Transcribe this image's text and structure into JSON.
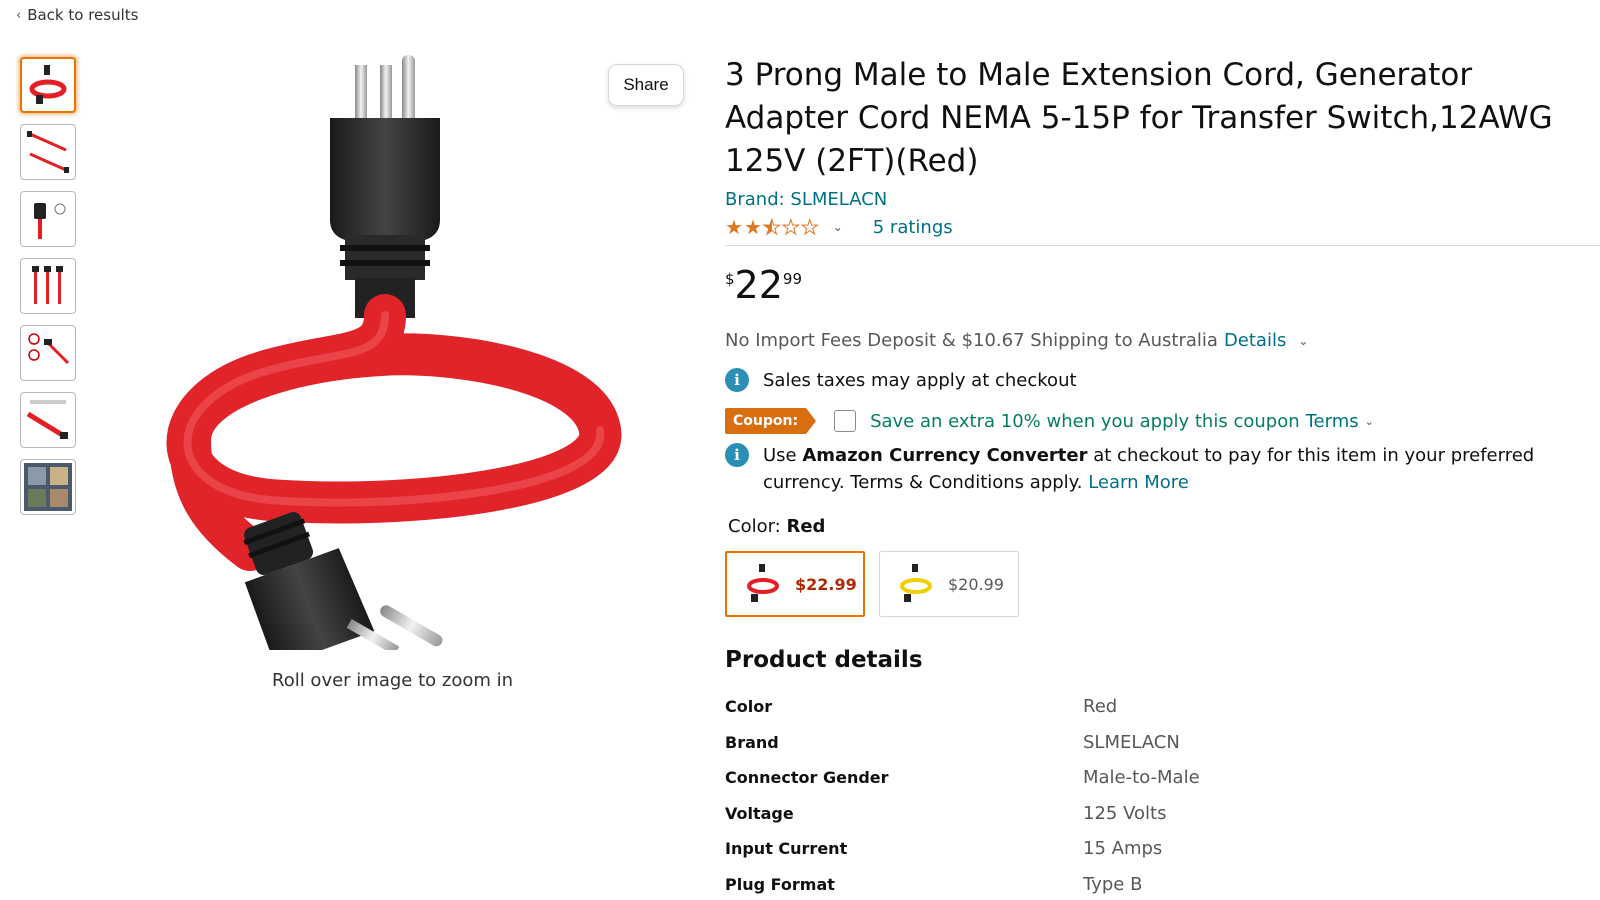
{
  "nav": {
    "back_label": "Back to results",
    "back_icon": "chevron-left-icon"
  },
  "gallery": {
    "thumbnails": [
      {
        "name": "red cord coiled"
      },
      {
        "name": "cord length diagram"
      },
      {
        "name": "plug detail"
      },
      {
        "name": "cords lined up"
      },
      {
        "name": "usage warnings"
      },
      {
        "name": "details drawing"
      },
      {
        "name": "application collage"
      }
    ],
    "share_label": "Share",
    "zoom_hint": "Roll over image to zoom in"
  },
  "product": {
    "title": "3 Prong Male to Male Extension Cord, Generator Adapter Cord NEMA 5-15P for Transfer Switch,12AWG 125V (2FT)(Red)",
    "brand": "Brand: SLMELACN",
    "rating": 2.5,
    "ratings_count": "5 ratings",
    "price": {
      "currency": "$",
      "whole": "22",
      "fraction": "99"
    },
    "shipping": {
      "text": "No Import Fees Deposit & $10.67 Shipping to Australia",
      "details_link": "Details"
    },
    "tax_note": "Sales taxes may apply at checkout",
    "coupon": {
      "tag": "Coupon:",
      "text": "Save an extra 10% when you apply this coupon",
      "terms": "Terms"
    },
    "converter": {
      "prefix": "Use",
      "bold": "Amazon Currency Converter",
      "suffix": "at checkout to pay for this item in your preferred currency. Terms & Conditions apply.",
      "link": "Learn More"
    },
    "color": {
      "label": "Color:",
      "selected": "Red",
      "options": [
        {
          "name": "Red",
          "price": "$22.99",
          "color": "#e31e24"
        },
        {
          "name": "Yellow",
          "price": "$20.99",
          "color": "#f2d000"
        }
      ]
    }
  },
  "product_details": {
    "title": "Product details",
    "rows": [
      {
        "key": "Color",
        "value": "Red"
      },
      {
        "key": "Brand",
        "value": "SLMELACN"
      },
      {
        "key": "Connector Gender",
        "value": "Male-to-Male"
      },
      {
        "key": "Voltage",
        "value": "125 Volts"
      },
      {
        "key": "Input Current",
        "value": "15 Amps"
      },
      {
        "key": "Plug Format",
        "value": "Type B"
      }
    ]
  },
  "colors": {
    "link": "#007185",
    "accent": "#e77600",
    "price_red": "#b12704",
    "coupon_green": "#067d62",
    "star": "#de7921"
  }
}
